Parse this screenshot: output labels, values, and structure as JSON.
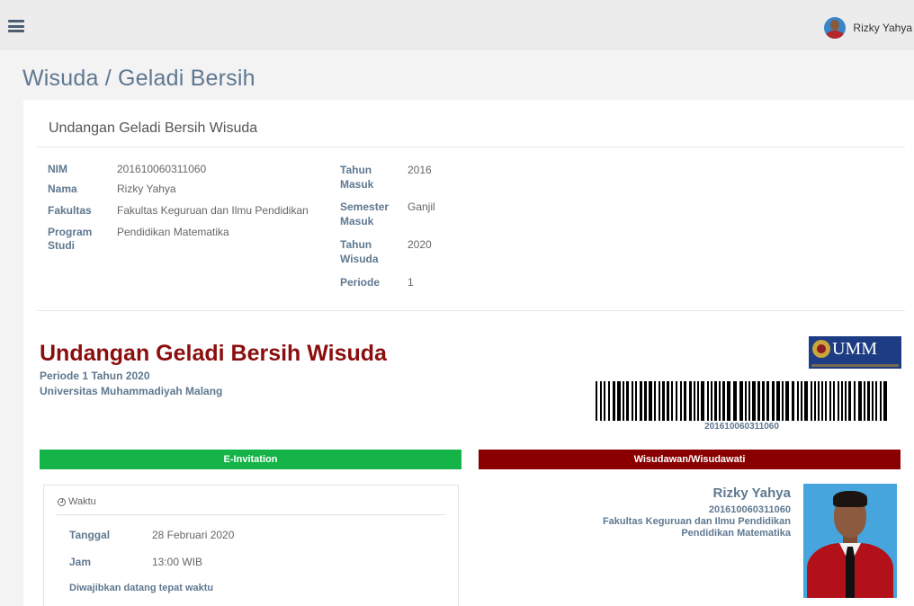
{
  "header": {
    "user_name": "Rizky Yahya"
  },
  "page": {
    "title": "Wisuda / Geladi Bersih"
  },
  "panel": {
    "title": "Undangan Geladi Bersih Wisuda"
  },
  "student_info_left": [
    {
      "label": "NIM",
      "value": "201610060311060"
    },
    {
      "label": "Nama",
      "value": "Rizky Yahya"
    },
    {
      "label": "Fakultas",
      "value": "Fakultas Keguruan dan Ilmu Pendidikan"
    },
    {
      "label": "Program Studi",
      "value": "Pendidikan Matematika"
    }
  ],
  "student_info_right": [
    {
      "label": "Tahun Masuk",
      "value": "2016"
    },
    {
      "label": "Semester Masuk",
      "value": "Ganjil"
    },
    {
      "label": "Tahun Wisuda",
      "value": "2020"
    },
    {
      "label": "Periode",
      "value": "1"
    }
  ],
  "invitation": {
    "title": "Undangan Geladi Bersih Wisuda",
    "period_line": "Periode 1 Tahun 2020",
    "university": "Universitas Muhammadiyah Malang",
    "logo_text": "UMM",
    "barcode_number": "201610060311060",
    "einvitation_label": "E-Invitation",
    "graduate_label": "Wisudawan/Wisudawati"
  },
  "schedule": {
    "heading": "Waktu",
    "icon": "clock-icon",
    "rows": [
      {
        "label": "Tanggal",
        "value": "28 Februari 2020"
      },
      {
        "label": "Jam",
        "value": "13:00 WIB"
      }
    ],
    "note": "Diwajibkan datang tepat waktu"
  },
  "graduate": {
    "name": "Rizky Yahya",
    "nim": "201610060311060",
    "faculty": "Fakultas Keguruan dan Ilmu Pendidikan",
    "program": "Pendidikan Matematika"
  },
  "colors": {
    "accent_red": "#8b0d0d",
    "green_band": "#15b449",
    "red_band": "#8a0000",
    "label_blue": "#5f7890"
  }
}
